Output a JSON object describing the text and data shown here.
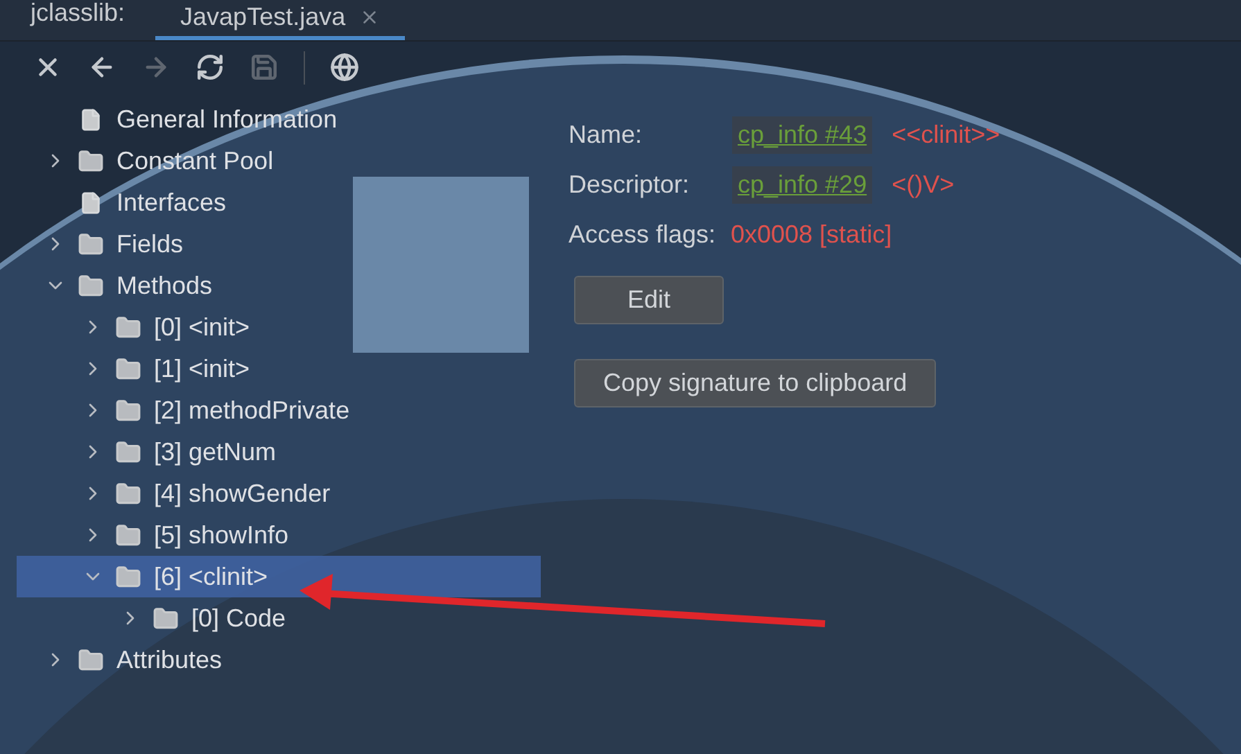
{
  "tab_bar": {
    "prefix": "jclasslib:",
    "tabs": [
      {
        "label": "JavapTest.java",
        "selected": true
      }
    ]
  },
  "toolbar": [
    {
      "kind": "close",
      "disabled": false
    },
    {
      "kind": "back",
      "disabled": false
    },
    {
      "kind": "forward",
      "disabled": true
    },
    {
      "kind": "refresh",
      "disabled": false
    },
    {
      "kind": "save",
      "disabled": true
    },
    {
      "kind": "web",
      "disabled": false
    }
  ],
  "tree": [
    {
      "label": "General Information",
      "kind": "file",
      "selected": false
    },
    {
      "label": "Constant Pool",
      "kind": "folder",
      "expanded": false,
      "selected": false
    },
    {
      "label": "Interfaces",
      "kind": "file",
      "selected": false
    },
    {
      "label": "Fields",
      "kind": "folder",
      "expanded": false,
      "selected": false
    },
    {
      "label": "Methods",
      "kind": "folder",
      "expanded": true,
      "selected": false,
      "children": [
        {
          "label": "[0] <init>",
          "kind": "folder",
          "expanded": false,
          "selected": false
        },
        {
          "label": "[1] <init>",
          "kind": "folder",
          "expanded": false,
          "selected": false
        },
        {
          "label": "[2] methodPrivate",
          "kind": "folder",
          "expanded": false,
          "selected": false
        },
        {
          "label": "[3] getNum",
          "kind": "folder",
          "expanded": false,
          "selected": false
        },
        {
          "label": "[4] showGender",
          "kind": "folder",
          "expanded": false,
          "selected": false
        },
        {
          "label": "[5] showInfo",
          "kind": "folder",
          "expanded": false,
          "selected": false
        },
        {
          "label": "[6] <clinit>",
          "kind": "folder",
          "expanded": true,
          "selected": true,
          "children": [
            {
              "label": "[0] Code",
              "kind": "folder",
              "expanded": false,
              "selected": false
            }
          ]
        }
      ]
    },
    {
      "label": "Attributes",
      "kind": "folder",
      "expanded": false,
      "selected": false
    }
  ],
  "details": {
    "fields": [
      {
        "label": "Name:",
        "link": "cp_info #43",
        "value": "<<clinit>>"
      },
      {
        "label": "Descriptor:",
        "link": "cp_info #29",
        "value": "<()V>"
      },
      {
        "label": "Access flags:",
        "value": "0x0008 [static]"
      }
    ],
    "buttons": [
      "Edit",
      "Copy signature to clipboard"
    ]
  }
}
